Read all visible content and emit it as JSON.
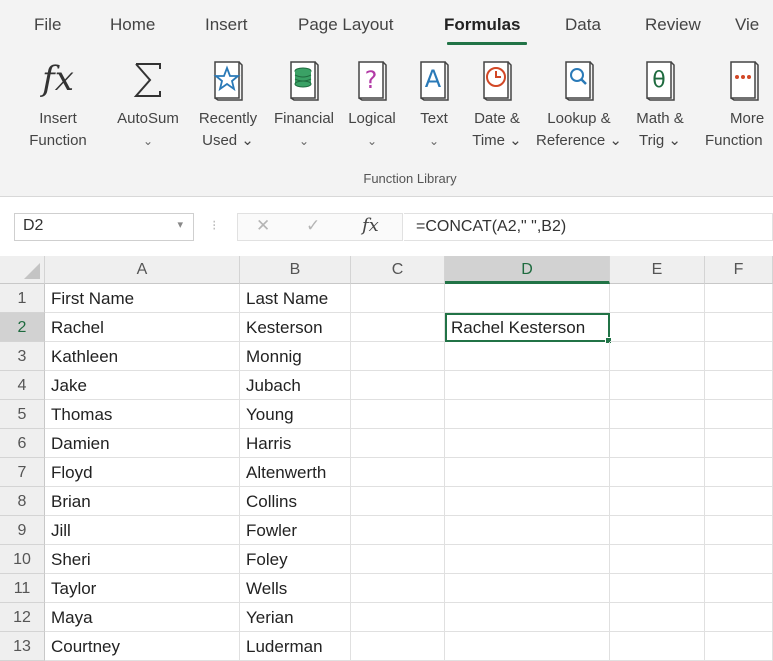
{
  "ribbon": {
    "tabs": [
      {
        "label": "File"
      },
      {
        "label": "Home"
      },
      {
        "label": "Insert"
      },
      {
        "label": "Page Layout"
      },
      {
        "label": "Formulas"
      },
      {
        "label": "Data"
      },
      {
        "label": "Review"
      },
      {
        "label": "Vie"
      }
    ],
    "active_tab": "Formulas",
    "accent_color": "#217346",
    "commands": [
      {
        "icon": "insert-function-icon",
        "line1": "Insert",
        "line2": "Function"
      },
      {
        "icon": "autosum-icon",
        "line1": "AutoSum",
        "line2": "⌄"
      },
      {
        "icon": "recently-used-star-icon",
        "line1": "Recently",
        "line2": "Used ⌄"
      },
      {
        "icon": "financial-icon",
        "line1": "Financial",
        "line2": "⌄"
      },
      {
        "icon": "logical-icon",
        "line1": "Logical",
        "line2": "⌄"
      },
      {
        "icon": "text-icon",
        "line1": "Text",
        "line2": "⌄"
      },
      {
        "icon": "date-time-icon",
        "line1": "Date &",
        "line2": "Time ⌄"
      },
      {
        "icon": "lookup-reference-icon",
        "line1": "Lookup &",
        "line2": "Reference ⌄"
      },
      {
        "icon": "math-trig-icon",
        "line1": "Math &",
        "line2": "Trig ⌄"
      },
      {
        "icon": "more-functions-icon",
        "line1": "More",
        "line2": "Function"
      }
    ],
    "group_label": "Function Library"
  },
  "formula_bar": {
    "name_box": "D2",
    "cancel_glyph": "✕",
    "enter_glyph": "✓",
    "fx_label": "fx",
    "formula": "=CONCAT(A2,\" \",B2)"
  },
  "sheet": {
    "columns": [
      "A",
      "B",
      "C",
      "D",
      "E",
      "F"
    ],
    "selected_column": "D",
    "selected_row": "2",
    "active_cell": "D2",
    "rows": [
      {
        "num": "1",
        "A": "First Name",
        "B": "Last Name",
        "C": "",
        "D": "",
        "E": "",
        "F": ""
      },
      {
        "num": "2",
        "A": "Rachel",
        "B": "Kesterson",
        "C": "",
        "D": "Rachel Kesterson",
        "E": "",
        "F": ""
      },
      {
        "num": "3",
        "A": "Kathleen",
        "B": "Monnig",
        "C": "",
        "D": "",
        "E": "",
        "F": ""
      },
      {
        "num": "4",
        "A": "Jake",
        "B": "Jubach",
        "C": "",
        "D": "",
        "E": "",
        "F": ""
      },
      {
        "num": "5",
        "A": "Thomas",
        "B": "Young",
        "C": "",
        "D": "",
        "E": "",
        "F": ""
      },
      {
        "num": "6",
        "A": "Damien",
        "B": "Harris",
        "C": "",
        "D": "",
        "E": "",
        "F": ""
      },
      {
        "num": "7",
        "A": "Floyd",
        "B": "Altenwerth",
        "C": "",
        "D": "",
        "E": "",
        "F": ""
      },
      {
        "num": "8",
        "A": "Brian",
        "B": "Collins",
        "C": "",
        "D": "",
        "E": "",
        "F": ""
      },
      {
        "num": "9",
        "A": "Jill",
        "B": "Fowler",
        "C": "",
        "D": "",
        "E": "",
        "F": ""
      },
      {
        "num": "10",
        "A": "Sheri",
        "B": "Foley",
        "C": "",
        "D": "",
        "E": "",
        "F": ""
      },
      {
        "num": "11",
        "A": "Taylor",
        "B": "Wells",
        "C": "",
        "D": "",
        "E": "",
        "F": ""
      },
      {
        "num": "12",
        "A": "Maya",
        "B": "Yerian",
        "C": "",
        "D": "",
        "E": "",
        "F": ""
      },
      {
        "num": "13",
        "A": "Courtney",
        "B": "Luderman",
        "C": "",
        "D": "",
        "E": "",
        "F": ""
      }
    ]
  }
}
